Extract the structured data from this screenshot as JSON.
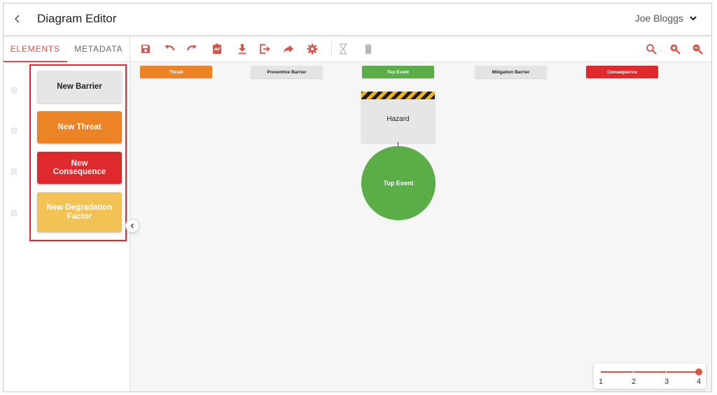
{
  "header": {
    "back_icon": "chevron-left-icon",
    "title": "Diagram Editor",
    "user_name": "Joe Bloggs",
    "user_menu_icon": "chevron-down-icon"
  },
  "tabs": [
    {
      "label": "ELEMENTS",
      "active": true
    },
    {
      "label": "METADATA",
      "active": false
    }
  ],
  "toolbar": {
    "left_icons": [
      "save-icon",
      "undo-icon",
      "redo-icon",
      "validate-icon",
      "download-icon",
      "export-icon",
      "share-icon",
      "settings-icon",
      "hourglass-icon",
      "delete-icon"
    ],
    "right_icons": [
      "search-icon",
      "zoom-in-icon",
      "zoom-out-icon"
    ],
    "accent": "#d9544a",
    "disabled_color": "#b5b5b5"
  },
  "elements": [
    {
      "label": "New Barrier",
      "bg": "#e6e6e6",
      "fg": "#222222"
    },
    {
      "label": "New Threat",
      "bg": "#ec8426",
      "fg": "#ffffff"
    },
    {
      "label": "New Consequence",
      "bg": "#e0292d",
      "fg": "#ffffff"
    },
    {
      "label": "New Degradation Factor",
      "bg": "#f2c254",
      "fg": "#ffffff"
    }
  ],
  "columns": [
    {
      "label": "Threat",
      "bg": "#ec8426",
      "fg": "#ffffff"
    },
    {
      "label": "Preventive Barrier",
      "bg": "#e4e4e4",
      "fg": "#222222"
    },
    {
      "label": "Top Event",
      "bg": "#5aad47",
      "fg": "#ffffff"
    },
    {
      "label": "Mitigation Barrier",
      "bg": "#e4e4e4",
      "fg": "#222222"
    },
    {
      "label": "Consequence",
      "bg": "#e0292d",
      "fg": "#ffffff"
    }
  ],
  "diagram": {
    "hazard_label": "Hazard",
    "top_event_label": "Top Event"
  },
  "level_slider": {
    "labels": [
      "1",
      "2",
      "3",
      "4"
    ],
    "value": 4
  }
}
